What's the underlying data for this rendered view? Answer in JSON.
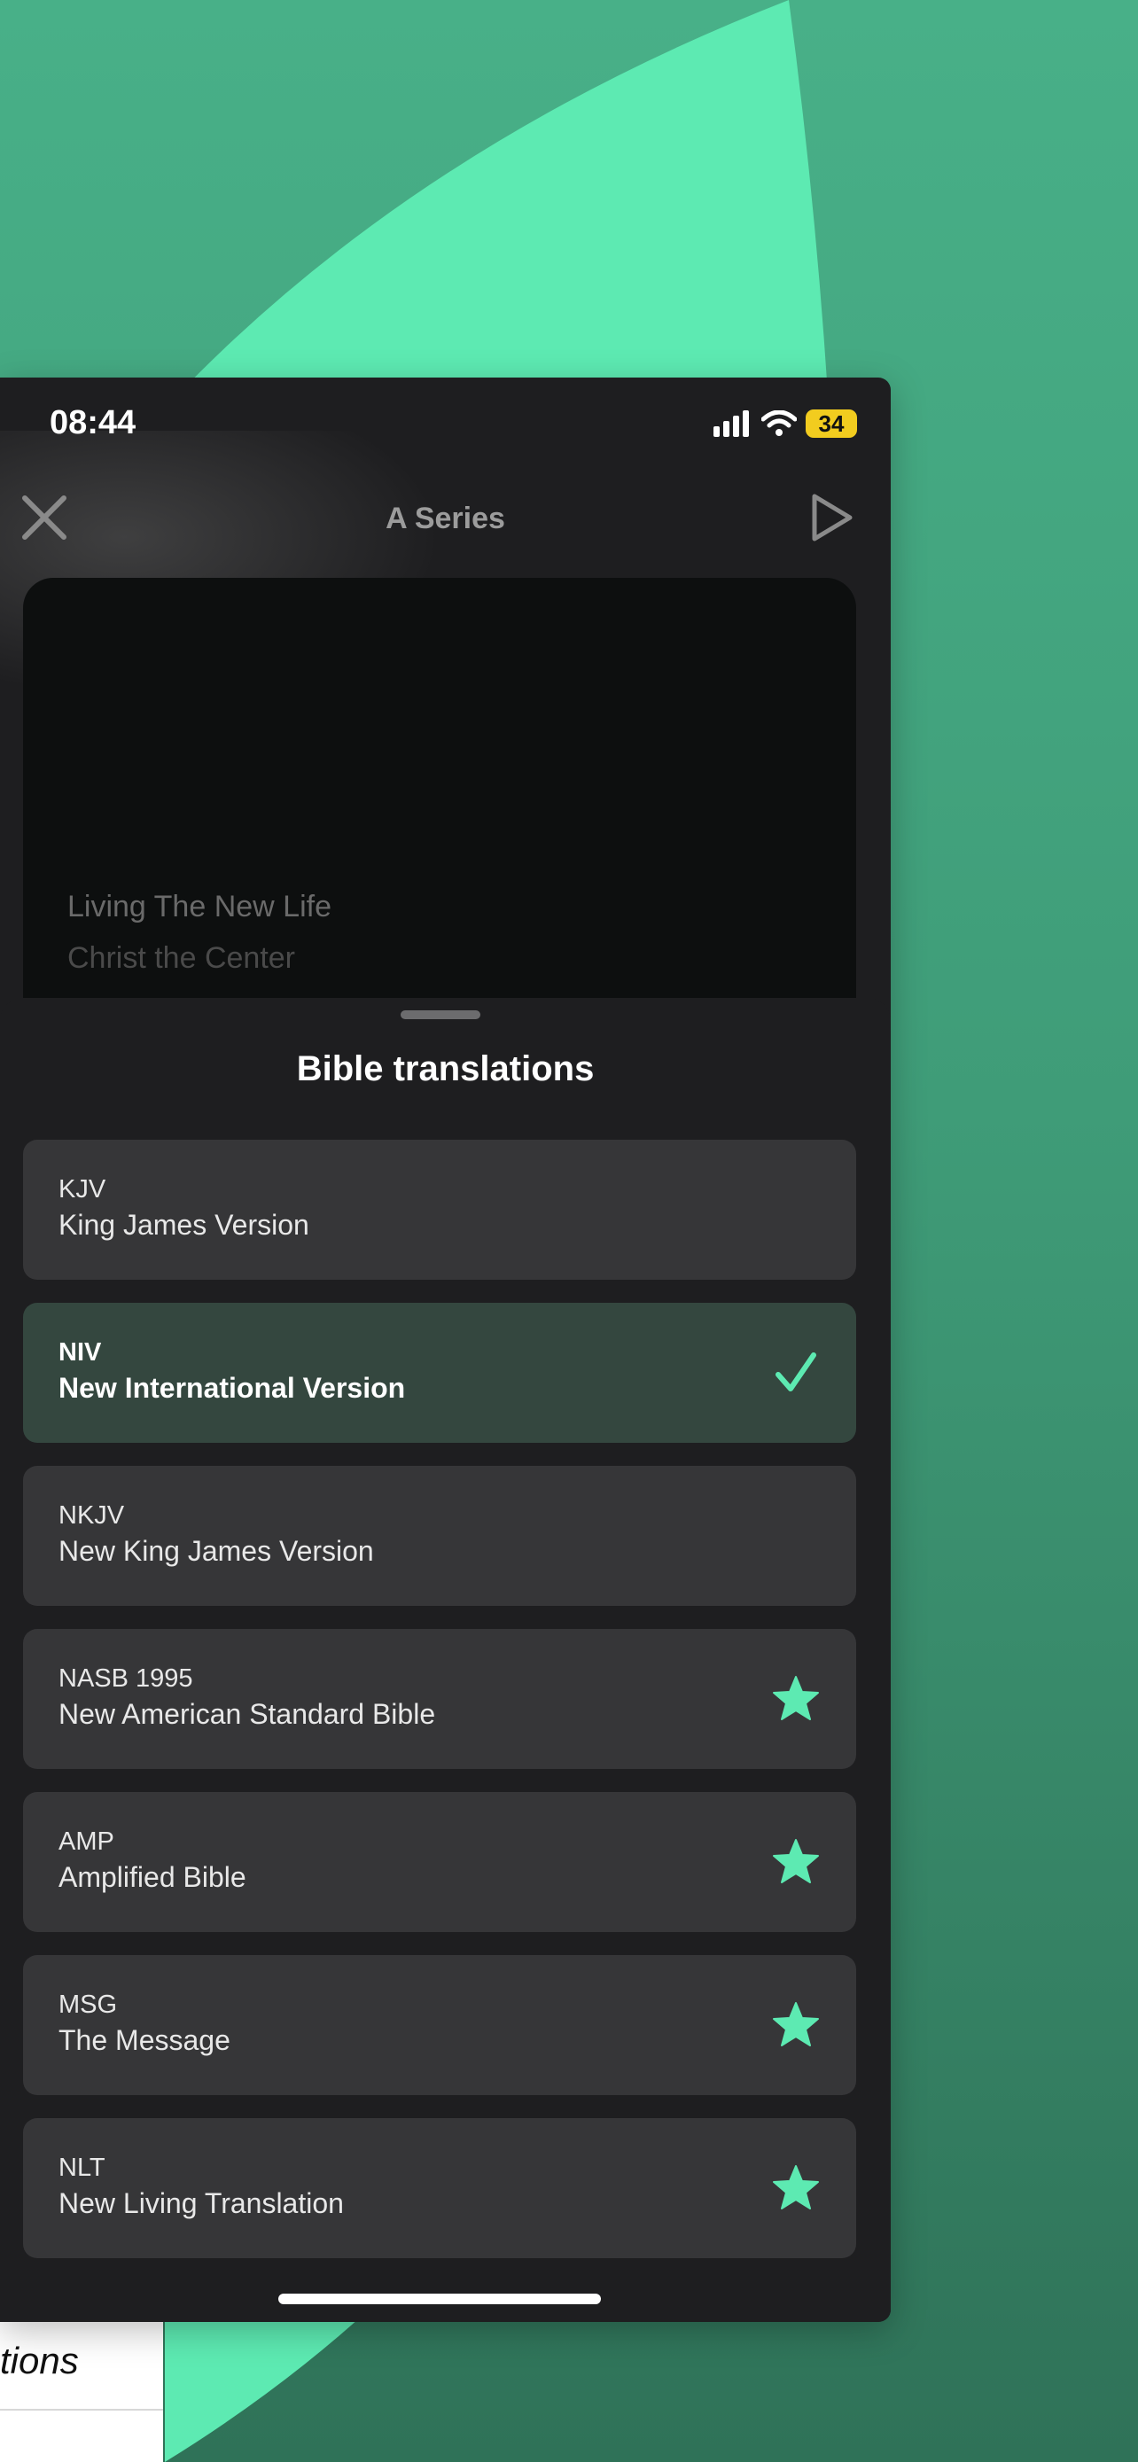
{
  "status_bar": {
    "time": "08:44",
    "battery": "34"
  },
  "nav": {
    "title": "A Series",
    "close_icon": "close-icon",
    "play_icon": "play-icon"
  },
  "video": {
    "title": "Living The New Life",
    "subtitle": "Christ the Center"
  },
  "sheet": {
    "title": "Bible translations",
    "items": [
      {
        "abbr": "KJV",
        "name": "King James Version",
        "state": "none"
      },
      {
        "abbr": "NIV",
        "name": "New International Version",
        "state": "selected"
      },
      {
        "abbr": "NKJV",
        "name": "New King James Version",
        "state": "none"
      },
      {
        "abbr": "NASB 1995",
        "name": "New American Standard Bible",
        "state": "premium"
      },
      {
        "abbr": "AMP",
        "name": "Amplified Bible",
        "state": "premium"
      },
      {
        "abbr": "MSG",
        "name": "The Message",
        "state": "premium"
      },
      {
        "abbr": "NLT",
        "name": "New Living Translation",
        "state": "premium"
      }
    ]
  },
  "background_screen": {
    "text": "tions"
  },
  "colors": {
    "accent": "#5deab2",
    "background": "#3f9c78",
    "sheet": "#1e1e20",
    "row": "#363638",
    "selected_row": "#34473f"
  }
}
